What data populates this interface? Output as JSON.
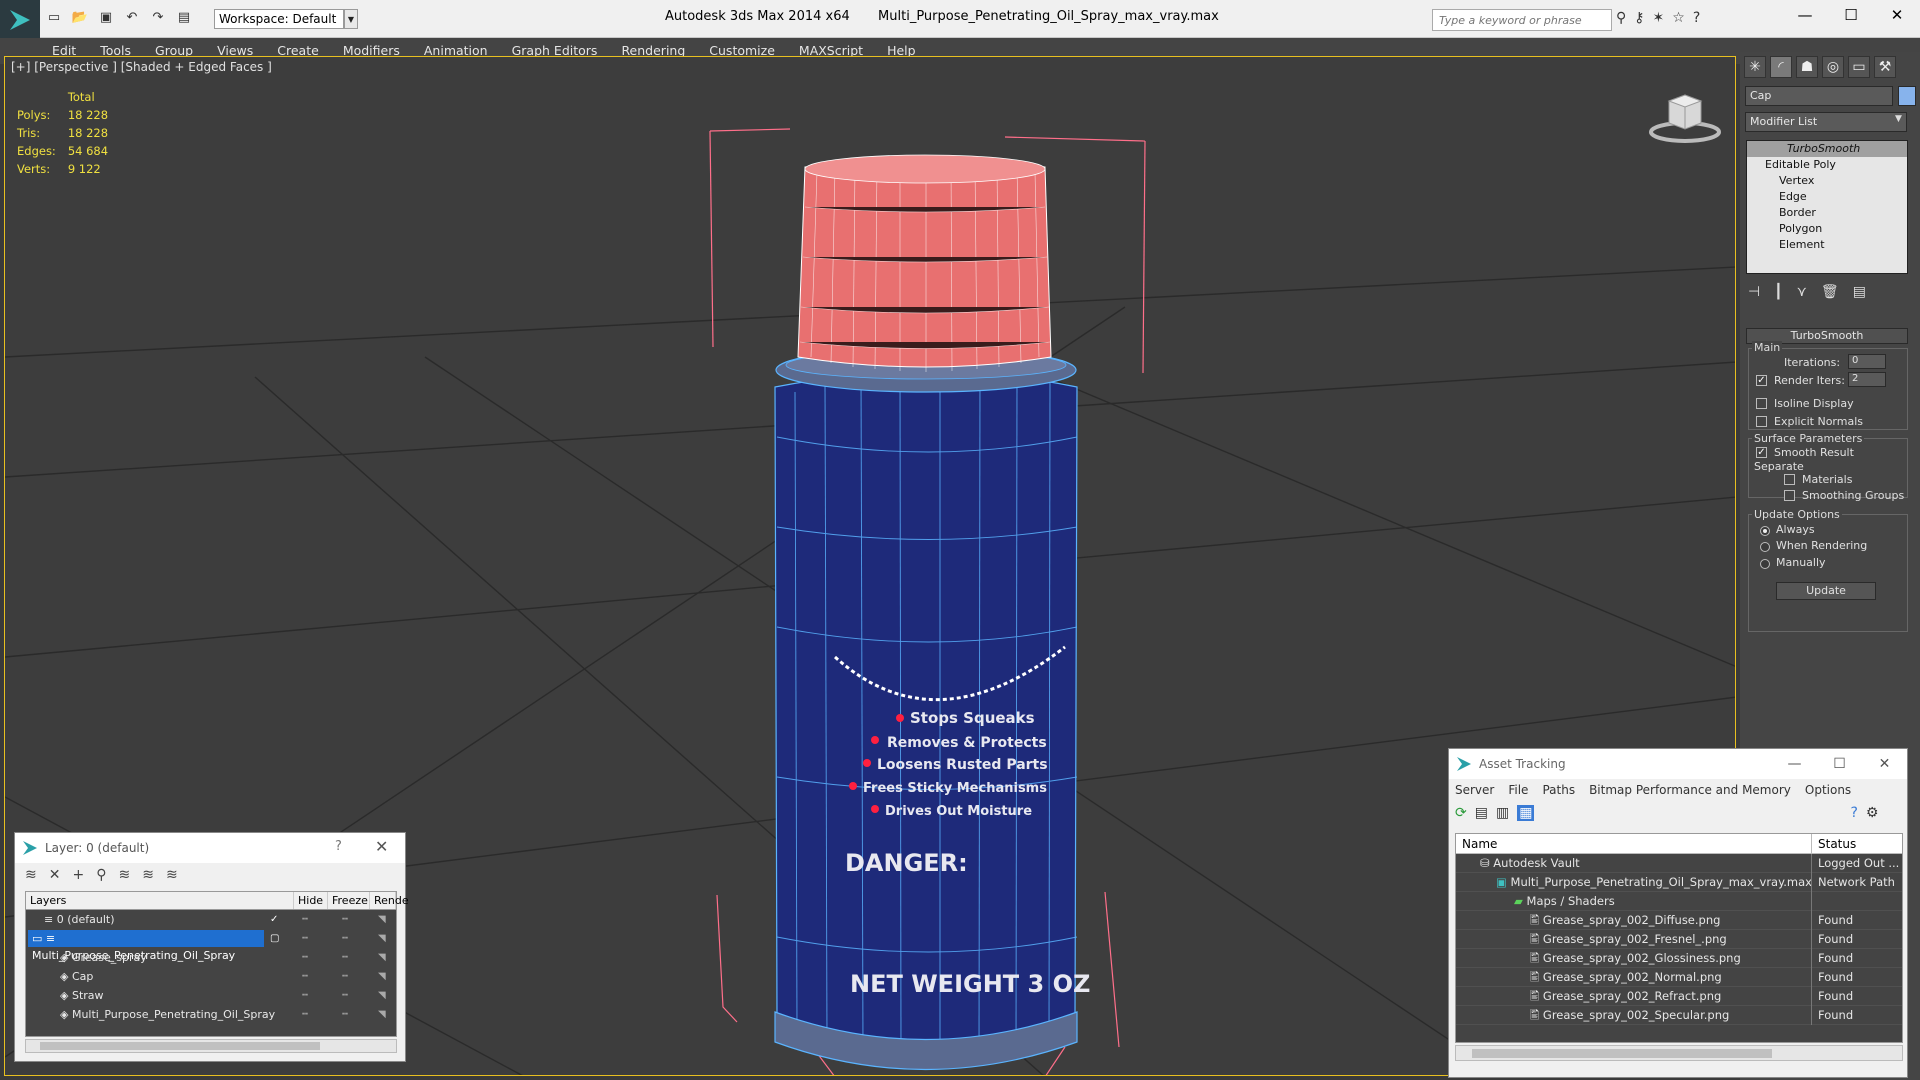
{
  "window": {
    "app_title": "Autodesk 3ds Max  2014 x64",
    "file_title": "Multi_Purpose_Penetrating_Oil_Spray_max_vray.max",
    "workspace": "Workspace: Default",
    "search_placeholder": "Type a keyword or phrase"
  },
  "menu": [
    "Edit",
    "Tools",
    "Group",
    "Views",
    "Create",
    "Modifiers",
    "Animation",
    "Graph Editors",
    "Rendering",
    "Customize",
    "MAXScript",
    "Help"
  ],
  "viewport": {
    "label": "[+] [Perspective ] [Shaded + Edged Faces ]",
    "stats": {
      "total_label": "Total",
      "rows": [
        {
          "label": "Polys:",
          "value": "18 228"
        },
        {
          "label": "Tris:",
          "value": "18 228"
        },
        {
          "label": "Edges:",
          "value": "54 684"
        },
        {
          "label": "Verts:",
          "value": "9 122"
        }
      ]
    },
    "label_text": {
      "line1": "Stops Squeaks",
      "line2": "Removes & Protects",
      "line3": "Loosens Rusted Parts",
      "line4": "Frees Sticky Mechanisms",
      "line5": "Drives Out Moisture",
      "danger": "DANGER:",
      "net_weight": "NET WEIGHT 3 OZ"
    }
  },
  "command_panel": {
    "object_name": "Cap",
    "modifier_list": "Modifier List",
    "stack": {
      "turbo": "TurboSmooth",
      "editable_poly": "Editable Poly",
      "subs": [
        "Vertex",
        "Edge",
        "Border",
        "Polygon",
        "Element"
      ]
    },
    "turbosmooth": {
      "title": "TurboSmooth",
      "main": "Main",
      "iterations_label": "Iterations:",
      "iterations": "0",
      "render_iters_label": "Render Iters:",
      "render_iters": "2",
      "isoline": "Isoline Display",
      "explicit_normals": "Explicit Normals",
      "surface_params": "Surface Parameters",
      "smooth_result": "Smooth Result",
      "separate": "Separate",
      "materials": "Materials",
      "smoothing_groups": "Smoothing Groups",
      "update_options": "Update Options",
      "always": "Always",
      "when_rendering": "When Rendering",
      "manually": "Manually",
      "update": "Update"
    }
  },
  "layer_dialog": {
    "title": "Layer: 0 (default)",
    "help": "?",
    "columns": [
      "Layers",
      "Hide",
      "Freeze",
      "Rende"
    ],
    "rows": [
      {
        "name": "0 (default)",
        "indent": 1,
        "selected": false
      },
      {
        "name": "Multi_Purpose_Penetrating_Oil_Spray",
        "indent": 1,
        "selected": true
      },
      {
        "name": "Grease_spray",
        "indent": 2,
        "selected": false
      },
      {
        "name": "Cap",
        "indent": 2,
        "selected": false
      },
      {
        "name": "Straw",
        "indent": 2,
        "selected": false
      },
      {
        "name": "Multi_Purpose_Penetrating_Oil_Spray",
        "indent": 2,
        "selected": false
      }
    ]
  },
  "asset_dialog": {
    "title": "Asset Tracking",
    "menu": [
      "Server",
      "File",
      "Paths",
      "Bitmap Performance and Memory",
      "Options"
    ],
    "columns": [
      "Name",
      "Status"
    ],
    "rows": [
      {
        "name": "Autodesk Vault",
        "status": "Logged Out ...",
        "indent": 1
      },
      {
        "name": "Multi_Purpose_Penetrating_Oil_Spray_max_vray.max",
        "status": "Network Path",
        "indent": 2
      },
      {
        "name": "Maps / Shaders",
        "status": "",
        "indent": 3
      },
      {
        "name": "Grease_spray_002_Diffuse.png",
        "status": "Found",
        "indent": 4
      },
      {
        "name": "Grease_spray_002_Fresnel_.png",
        "status": "Found",
        "indent": 4
      },
      {
        "name": "Grease_spray_002_Glossiness.png",
        "status": "Found",
        "indent": 4
      },
      {
        "name": "Grease_spray_002_Normal.png",
        "status": "Found",
        "indent": 4
      },
      {
        "name": "Grease_spray_002_Refract.png",
        "status": "Found",
        "indent": 4
      },
      {
        "name": "Grease_spray_002_Specular.png",
        "status": "Found",
        "indent": 4
      }
    ]
  },
  "colors": {
    "can_body": "#1e2a7a",
    "cap": "#e87070",
    "wire": "#5ab4ff",
    "selection": "#1f6fd0",
    "stats_text": "#f0e040",
    "bbox": "#ff6f8a"
  }
}
